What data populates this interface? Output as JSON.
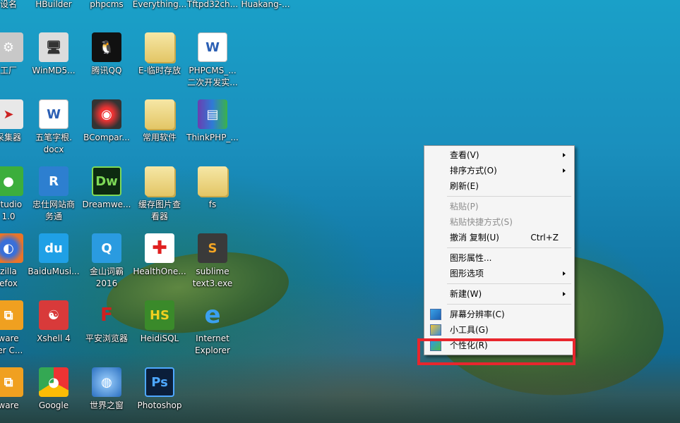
{
  "desktop": {
    "icons": [
      {
        "label": "设名",
        "glyph": "",
        "kind": "app"
      },
      {
        "label": "HBuilder",
        "glyph": "",
        "kind": "app"
      },
      {
        "label": "phpcms",
        "glyph": "",
        "kind": "app"
      },
      {
        "label": "Everything...",
        "glyph": "",
        "kind": "app"
      },
      {
        "label": "Tftpd32ch...",
        "glyph": "",
        "kind": "app"
      },
      {
        "label": "Huakang-...",
        "glyph": "",
        "kind": "app"
      },
      {
        "label": "工厂",
        "glyph": "⚙",
        "kind": "app"
      },
      {
        "label": "WinMD5...",
        "glyph": "🖥",
        "kind": "app"
      },
      {
        "label": "腾讯QQ",
        "glyph": "🐧",
        "kind": "app"
      },
      {
        "label": "E-临时存放",
        "glyph": "",
        "kind": "folder"
      },
      {
        "label": "PHPCMS_...\n二次开发实...",
        "glyph": "W",
        "kind": "doc"
      },
      {
        "label": "采集器",
        "glyph": "➤",
        "kind": "app"
      },
      {
        "label": "五笔字根.\ndocx",
        "glyph": "W",
        "kind": "doc"
      },
      {
        "label": "BCompar...",
        "glyph": "◉",
        "kind": "app"
      },
      {
        "label": "常用软件",
        "glyph": "",
        "kind": "folder"
      },
      {
        "label": "ThinkPHP_...",
        "glyph": "▤",
        "kind": "app"
      },
      {
        "label": "Studio\n1.0",
        "glyph": "●",
        "kind": "app"
      },
      {
        "label": "忠仕网站商\n务通",
        "glyph": "R",
        "kind": "app"
      },
      {
        "label": "Dreamwe...",
        "glyph": "Dw",
        "kind": "app"
      },
      {
        "label": "缓存图片查\n看器",
        "glyph": "",
        "kind": "folder"
      },
      {
        "label": "fs",
        "glyph": "",
        "kind": "folder"
      },
      {
        "label": "zilla\nefox",
        "glyph": "◐",
        "kind": "app"
      },
      {
        "label": "BaiduMusi...",
        "glyph": "du",
        "kind": "app"
      },
      {
        "label": "金山词霸\n2016",
        "glyph": "Q",
        "kind": "app"
      },
      {
        "label": "HealthOne...",
        "glyph": "✚",
        "kind": "app"
      },
      {
        "label": "sublime\ntext3.exe",
        "glyph": "S",
        "kind": "app"
      },
      {
        "label": "ware\nter C...",
        "glyph": "⧉",
        "kind": "app"
      },
      {
        "label": "Xshell 4",
        "glyph": "☯",
        "kind": "app"
      },
      {
        "label": "平安浏览器",
        "glyph": "F",
        "kind": "app"
      },
      {
        "label": "HeidiSQL",
        "glyph": "HS",
        "kind": "app"
      },
      {
        "label": "Internet\nExplorer",
        "glyph": "e",
        "kind": "app"
      },
      {
        "label": "ware",
        "glyph": "⧉",
        "kind": "app"
      },
      {
        "label": "Google",
        "glyph": "◕",
        "kind": "app"
      },
      {
        "label": "世界之窗",
        "glyph": "◍",
        "kind": "app"
      },
      {
        "label": "Photoshop",
        "glyph": "Ps",
        "kind": "app"
      }
    ]
  },
  "context_menu": {
    "items": [
      {
        "label": "查看(V)",
        "submenu": true
      },
      {
        "label": "排序方式(O)",
        "submenu": true
      },
      {
        "label": "刷新(E)"
      },
      {
        "sep": true
      },
      {
        "label": "粘贴(P)",
        "disabled": true
      },
      {
        "label": "粘贴快捷方式(S)",
        "disabled": true
      },
      {
        "label": "撤消 复制(U)",
        "shortcut": "Ctrl+Z"
      },
      {
        "sep": true
      },
      {
        "label": "图形属性..."
      },
      {
        "label": "图形选项",
        "submenu": true
      },
      {
        "sep": true
      },
      {
        "label": "新建(W)",
        "submenu": true
      },
      {
        "sep": true
      },
      {
        "label": "屏幕分辨率(C)",
        "icon": "display-icon"
      },
      {
        "label": "小工具(G)",
        "icon": "gadgets-icon"
      },
      {
        "label": "个性化(R)",
        "icon": "personalize-icon"
      }
    ]
  },
  "colors": {
    "highlight_border": "#e8262d"
  }
}
